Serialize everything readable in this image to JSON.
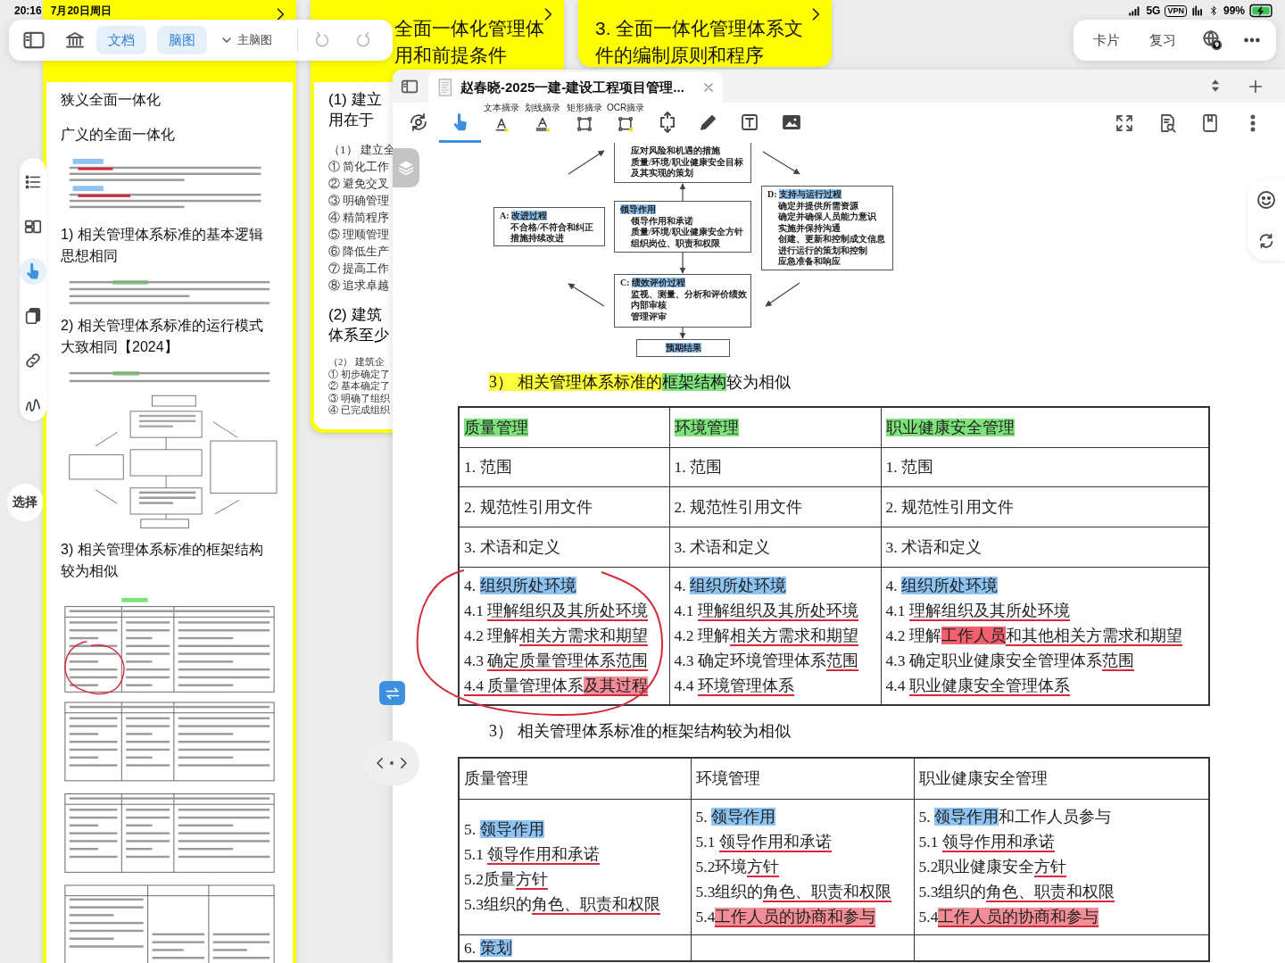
{
  "status_bar": {
    "time": "20:16",
    "date": "7月20日周日",
    "network": "5G",
    "vpn": "VPN",
    "battery": "99%"
  },
  "top_toolbar": {
    "view_tabs": [
      {
        "label": "文档",
        "selected": true
      },
      {
        "label": "脑图",
        "selected": true
      }
    ],
    "map_selector": "主脑图"
  },
  "right_bar": {
    "buttons": [
      "卡片",
      "复习"
    ]
  },
  "side_tools": [
    {
      "kind": "outline",
      "selected": false
    },
    {
      "kind": "cards",
      "selected": false
    },
    {
      "kind": "hand",
      "selected": true
    },
    {
      "kind": "copy",
      "selected": false
    },
    {
      "kind": "link",
      "selected": false
    },
    {
      "kind": "draw",
      "selected": false
    }
  ],
  "select_button": "选择",
  "cards": [
    {
      "items": [
        {
          "kind": "text",
          "text": "狭义全面一体化"
        },
        {
          "kind": "text",
          "text": "广义的全面一体化"
        },
        {
          "kind": "thumbnail_text"
        },
        {
          "kind": "heading",
          "text": "1) 相关管理体系标准的基本逻辑思想相同"
        },
        {
          "kind": "thumbnail_short"
        },
        {
          "kind": "heading",
          "text": "2) 相关管理体系标准的运行模式大致相同【2024】"
        },
        {
          "kind": "thumbnail_diagram"
        },
        {
          "kind": "heading",
          "text": "3) 相关管理体系标准的框架结构较为相似"
        },
        {
          "kind": "thumbnail_table"
        }
      ]
    },
    {
      "title_lines": [
        "全面一体化管理体",
        "用和前提条件"
      ],
      "items": [
        {
          "kind": "heading_line",
          "text": "(1) 建立"
        },
        {
          "kind": "heading_line",
          "text": "用在于"
        },
        {
          "kind": "line",
          "text": "（1） 建立全"
        },
        {
          "kind": "line",
          "text": "① 简化工作"
        },
        {
          "kind": "line",
          "text": "② 避免交叉"
        },
        {
          "kind": "line",
          "text": "③ 明确管理"
        },
        {
          "kind": "line",
          "text": "④ 精简程序"
        },
        {
          "kind": "line",
          "text": "⑤ 理顺管理"
        },
        {
          "kind": "line",
          "text": "⑥ 降低生产"
        },
        {
          "kind": "line",
          "text": "⑦ 提高工作"
        },
        {
          "kind": "line",
          "text": "⑧ 追求卓越"
        },
        {
          "kind": "heading_line",
          "text": "(2) 建筑"
        },
        {
          "kind": "heading_line",
          "text": "体系至少"
        },
        {
          "kind": "small",
          "text": "（2） 建筑企"
        },
        {
          "kind": "small",
          "text": "① 初步确定了"
        },
        {
          "kind": "small",
          "text": "② 基本确定了"
        },
        {
          "kind": "small",
          "text": "③ 明确了组织"
        },
        {
          "kind": "small",
          "text": "④ 已完成组织"
        }
      ]
    },
    {
      "title_lines": [
        "3. 全面一体化管理体系文",
        "件的编制原则和程序"
      ]
    }
  ],
  "document": {
    "tab_title": "赵春晓-2025一建-建设工程项目管理...",
    "tools": [
      {
        "kind": "sync",
        "selected": false
      },
      {
        "kind": "hand",
        "selected": true
      },
      {
        "kind": "text_excerpt",
        "label": "文本摘录",
        "selected": false
      },
      {
        "kind": "line_excerpt",
        "label": "划线摘录",
        "selected": false
      },
      {
        "kind": "rect_excerpt",
        "label": "矩形摘录",
        "selected": false
      },
      {
        "kind": "ocr_excerpt",
        "label": "OCR摘录",
        "selected": false
      },
      {
        "kind": "resize",
        "selected": false
      },
      {
        "kind": "pencil",
        "selected": false
      },
      {
        "kind": "textbox",
        "selected": false
      },
      {
        "kind": "image",
        "selected": false
      }
    ],
    "right_tools": [
      {
        "kind": "expand"
      },
      {
        "kind": "search_doc"
      },
      {
        "kind": "bookmark"
      },
      {
        "kind": "more"
      }
    ],
    "diagram": [
      {
        "kind": "plan",
        "lines": [
          "应对风险和机遇的措施",
          "质量/环境/职业健康安全目标",
          "及其实现的策划"
        ]
      },
      {
        "kind": "act",
        "lines": [
          [
            {
              "text": "A: ",
              "kind": "plain"
            },
            {
              "text": "改进过程",
              "kind": "blue"
            }
          ],
          "不合格/不符合和纠正",
          "措施持续改进"
        ]
      },
      {
        "kind": "leader",
        "lines": [
          [
            {
              "text": "领导作用",
              "kind": "blue"
            }
          ],
          "领导作用和承诺",
          "质量/环境/职业健康安全方针",
          "组织岗位、职责和权限"
        ]
      },
      {
        "kind": "do",
        "lines": [
          [
            {
              "text": "D: ",
              "kind": "plain"
            },
            {
              "text": "支持与运行过程",
              "kind": "blue"
            }
          ],
          "确定并提供所需资源",
          "确定并确保人员能力意识",
          "实施并保持沟通",
          "创建、更新和控制成文信息",
          "进行运行的策划和控制",
          "应急准备和响应"
        ]
      },
      {
        "kind": "check",
        "lines": [
          [
            {
              "text": "C: ",
              "kind": "plain"
            },
            {
              "text": "绩效评价过程",
              "kind": "blue"
            }
          ],
          "监视、测量、分析和评价绩效",
          "内部审核",
          "管理评审"
        ]
      },
      {
        "kind": "result",
        "lines": [
          [
            {
              "text": "预期结果",
              "kind": "blue"
            }
          ]
        ]
      }
    ],
    "sections": [
      {
        "heading": [
          {
            "text": "3） 相关管理体系标准的",
            "kind": "yellow"
          },
          {
            "text": "框架结构",
            "kind": "green"
          },
          {
            "text": "较为相似",
            "kind": "plain"
          }
        ],
        "table": {
          "rows": [
            {
              "cells": [
                {
                  "lines": [
                    [
                      {
                        "text": "质量管理",
                        "kind": "green"
                      }
                    ]
                  ]
                },
                {
                  "lines": [
                    [
                      {
                        "text": "环境管理",
                        "kind": "green"
                      }
                    ]
                  ]
                },
                {
                  "lines": [
                    [
                      {
                        "text": "职业健康安全管理",
                        "kind": "green"
                      }
                    ]
                  ]
                }
              ]
            },
            {
              "cells": [
                {
                  "lines": [
                    "1. 范围"
                  ]
                },
                {
                  "lines": [
                    "1. 范围"
                  ]
                },
                {
                  "lines": [
                    "1. 范围"
                  ]
                }
              ]
            },
            {
              "cells": [
                {
                  "lines": [
                    "2. 规范性引用文件"
                  ]
                },
                {
                  "lines": [
                    "2. 规范性引用文件"
                  ]
                },
                {
                  "lines": [
                    "2. 规范性引用文件"
                  ]
                }
              ]
            },
            {
              "cells": [
                {
                  "lines": [
                    "3. 术语和定义"
                  ]
                },
                {
                  "lines": [
                    "3. 术语和定义"
                  ]
                },
                {
                  "lines": [
                    "3. 术语和定义"
                  ]
                }
              ]
            },
            {
              "cells": [
                {
                  "lines": [
                    [
                      {
                        "text": "4. ",
                        "kind": "plain"
                      },
                      {
                        "text": "组织所处环境",
                        "kind": "blue"
                      }
                    ],
                    [
                      {
                        "text": "4.1 ",
                        "kind": "plain"
                      },
                      {
                        "text": "理解组织及其所处环境",
                        "kind": "uline"
                      }
                    ],
                    [
                      {
                        "text": "4.2 理解",
                        "kind": "plain"
                      },
                      {
                        "text": "相关方需求和期望",
                        "kind": "uline"
                      }
                    ],
                    [
                      {
                        "text": "4.3 ",
                        "kind": "plain"
                      },
                      {
                        "text": "确定质量管理体系范围",
                        "kind": "uline"
                      }
                    ],
                    [
                      {
                        "text": "4.4 质量管理体系",
                        "kind": "uline"
                      },
                      {
                        "text": "及其过程",
                        "kind": "red-uline"
                      }
                    ]
                  ]
                },
                {
                  "lines": [
                    [
                      {
                        "text": "4. ",
                        "kind": "plain"
                      },
                      {
                        "text": "组织所处环境",
                        "kind": "blue"
                      }
                    ],
                    [
                      {
                        "text": "4.1 ",
                        "kind": "plain"
                      },
                      {
                        "text": "理解组织及其所处环境",
                        "kind": "uline"
                      }
                    ],
                    [
                      {
                        "text": "4.2 理解",
                        "kind": "plain"
                      },
                      {
                        "text": "相关方需求和期望",
                        "kind": "uline"
                      }
                    ],
                    [
                      {
                        "text": "4.3 确定环境管理体系",
                        "kind": "plain"
                      },
                      {
                        "text": "范围",
                        "kind": "uline"
                      }
                    ],
                    [
                      {
                        "text": "4.4 ",
                        "kind": "plain"
                      },
                      {
                        "text": "环境管理体系",
                        "kind": "uline"
                      }
                    ]
                  ]
                },
                {
                  "lines": [
                    [
                      {
                        "text": "4. ",
                        "kind": "plain"
                      },
                      {
                        "text": "组织所处环境",
                        "kind": "blue"
                      }
                    ],
                    [
                      {
                        "text": "4.1 ",
                        "kind": "plain"
                      },
                      {
                        "text": "理解组织及其所处环境",
                        "kind": "uline"
                      }
                    ],
                    [
                      {
                        "text": "4.2 理解",
                        "kind": "plain"
                      },
                      {
                        "text": "工作人员",
                        "kind": "red"
                      },
                      {
                        "text": "和其他相关方需求和期望",
                        "kind": "uline"
                      }
                    ],
                    [
                      {
                        "text": "4.3 确定职业健康安全管理体系",
                        "kind": "plain"
                      },
                      {
                        "text": "范围",
                        "kind": "uline"
                      }
                    ],
                    [
                      {
                        "text": "4.4 ",
                        "kind": "plain"
                      },
                      {
                        "text": "职业健康安全管理体系",
                        "kind": "uline"
                      }
                    ]
                  ]
                }
              ]
            }
          ]
        }
      },
      {
        "heading": [
          {
            "text": "3） 相关管理体系标准的框架结构较为相似",
            "kind": "plain"
          }
        ],
        "table": {
          "rows": [
            {
              "cells": [
                {
                  "lines": [
                    "质量管理"
                  ]
                },
                {
                  "lines": [
                    "环境管理"
                  ]
                },
                {
                  "lines": [
                    "职业健康安全管理"
                  ]
                }
              ]
            },
            {
              "cells": [
                {
                  "lines": [
                    [
                      {
                        "text": "5. ",
                        "kind": "plain"
                      },
                      {
                        "text": "领导作用",
                        "kind": "blue"
                      }
                    ],
                    [
                      {
                        "text": "5.1 ",
                        "kind": "plain"
                      },
                      {
                        "text": "领导作用和承诺",
                        "kind": "uline"
                      }
                    ],
                    [
                      {
                        "text": "5.2质量",
                        "kind": "plain"
                      },
                      {
                        "text": "方针",
                        "kind": "uline"
                      }
                    ],
                    [
                      {
                        "text": "5.3组织的",
                        "kind": "plain"
                      },
                      {
                        "text": "角色、职责和权限",
                        "kind": "uline"
                      }
                    ]
                  ]
                },
                {
                  "lines": [
                    [
                      {
                        "text": "5. ",
                        "kind": "plain"
                      },
                      {
                        "text": "领导作用",
                        "kind": "blue"
                      }
                    ],
                    [
                      {
                        "text": "5.1 ",
                        "kind": "plain"
                      },
                      {
                        "text": "领导作用和承诺",
                        "kind": "uline"
                      }
                    ],
                    [
                      {
                        "text": "5.2环境",
                        "kind": "plain"
                      },
                      {
                        "text": "方针",
                        "kind": "uline"
                      }
                    ],
                    [
                      {
                        "text": "5.3组织的",
                        "kind": "plain"
                      },
                      {
                        "text": "角色、职责和权限",
                        "kind": "uline"
                      }
                    ],
                    [
                      {
                        "text": "5.4",
                        "kind": "plain"
                      },
                      {
                        "text": "工作人员的协商和参与",
                        "kind": "red-uline"
                      }
                    ]
                  ]
                },
                {
                  "lines": [
                    [
                      {
                        "text": "5. ",
                        "kind": "plain"
                      },
                      {
                        "text": "领导作用",
                        "kind": "blue"
                      },
                      {
                        "text": "和工作人员参与",
                        "kind": "plain"
                      }
                    ],
                    [
                      {
                        "text": "5.1 ",
                        "kind": "plain"
                      },
                      {
                        "text": "领导作用和承诺",
                        "kind": "uline"
                      }
                    ],
                    [
                      {
                        "text": "5.2职业健康安全",
                        "kind": "plain"
                      },
                      {
                        "text": "方针",
                        "kind": "uline"
                      }
                    ],
                    [
                      {
                        "text": "5.3组织的",
                        "kind": "plain"
                      },
                      {
                        "text": "角色、职责和权限",
                        "kind": "uline"
                      }
                    ],
                    [
                      {
                        "text": "5.4",
                        "kind": "plain"
                      },
                      {
                        "text": "工作人员的协商和参与",
                        "kind": "red-uline"
                      }
                    ]
                  ]
                }
              ]
            },
            {
              "cells": [
                {
                  "lines": [
                    [
                      {
                        "text": "6. ",
                        "kind": "plain"
                      },
                      {
                        "text": "策划",
                        "kind": "blue"
                      }
                    ]
                  ]
                }
              ]
            }
          ]
        }
      }
    ]
  }
}
